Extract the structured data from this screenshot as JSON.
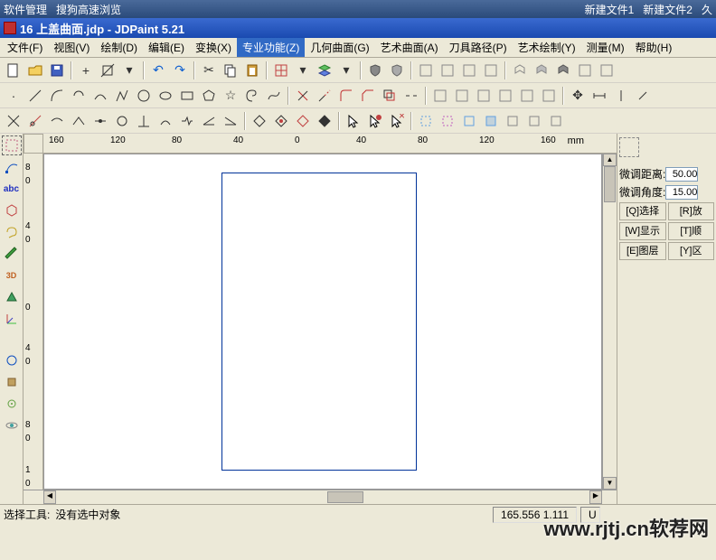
{
  "taskbar": {
    "items": [
      "软件管理",
      "搜狗高速浏览",
      "新建文件1",
      "新建文件2",
      "久"
    ]
  },
  "title": "16 上盖曲面.jdp - JDPaint 5.21",
  "menu": [
    {
      "label": "文件(F)",
      "active": false
    },
    {
      "label": "视图(V)",
      "active": false
    },
    {
      "label": "绘制(D)",
      "active": false
    },
    {
      "label": "编辑(E)",
      "active": false
    },
    {
      "label": "变换(X)",
      "active": false
    },
    {
      "label": "专业功能(Z)",
      "active": true
    },
    {
      "label": "几何曲面(G)",
      "active": false
    },
    {
      "label": "艺术曲面(A)",
      "active": false
    },
    {
      "label": "刀具路径(P)",
      "active": false
    },
    {
      "label": "艺术绘制(Y)",
      "active": false
    },
    {
      "label": "测量(M)",
      "active": false
    },
    {
      "label": "帮助(H)",
      "active": false
    }
  ],
  "ruler": {
    "h_ticks": [
      "160",
      "120",
      "80",
      "40",
      "0",
      "40",
      "80",
      "120",
      "160"
    ],
    "unit": "mm",
    "v_ticks": [
      "8",
      "0",
      "4",
      "0",
      "0",
      "4",
      "0",
      "8",
      "0",
      "1",
      "0"
    ]
  },
  "right_panel": {
    "nudge_dist_label": "微调距离:",
    "nudge_dist_value": "50.00",
    "nudge_angle_label": "微调角度:",
    "nudge_angle_value": "15.00",
    "buttons": [
      {
        "l": "[Q]选择",
        "r": "[R]放"
      },
      {
        "l": "[W]显示",
        "r": "[T]顺"
      },
      {
        "l": "[E]图层",
        "r": "[Y]区"
      }
    ]
  },
  "statusbar": {
    "tool_label": "选择工具:",
    "tool_status": "没有选中对象",
    "coords": "165.556  1.111",
    "mode": "U"
  },
  "watermark": "www.rjtj.cn软荐网"
}
